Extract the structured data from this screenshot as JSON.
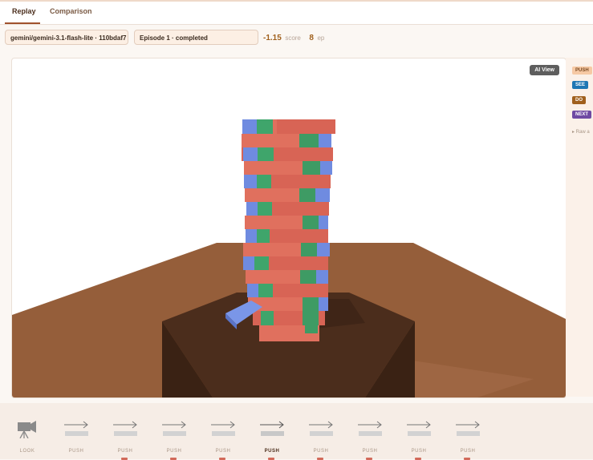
{
  "tabs": [
    {
      "label": "Replay",
      "active": true
    },
    {
      "label": "Comparison",
      "active": false
    }
  ],
  "toolbar": {
    "model": "gemini/gemini-3.1-flash-lite · 110bdaf7",
    "episode": "Episode 1 · completed",
    "score_value": "-1.15",
    "score_unit": "score",
    "ep_value": "8",
    "ep_unit": "ep"
  },
  "viewer": {
    "ai_view_label": "AI View"
  },
  "sidebar": {
    "tags": [
      {
        "label": "PUSH",
        "color": "#f6c9a4"
      },
      {
        "label": "SEE",
        "color": "#1f77b4"
      },
      {
        "label": "DO",
        "color": "#a0601d"
      },
      {
        "label": "NEXT",
        "color": "#6f4aa3"
      }
    ],
    "raw_label": "▸ Raw a"
  },
  "timeline": {
    "steps": [
      {
        "label": "LOOK",
        "icon": "camera-icon"
      },
      {
        "label": "PUSH",
        "icon": "arrow-right-icon"
      },
      {
        "label": "PUSH",
        "icon": "arrow-right-icon"
      },
      {
        "label": "PUSH",
        "icon": "arrow-right-icon"
      },
      {
        "label": "PUSH",
        "icon": "arrow-right-icon"
      },
      {
        "label": "PUSH",
        "icon": "arrow-right-icon",
        "active": true
      },
      {
        "label": "PUSH",
        "icon": "arrow-right-icon"
      },
      {
        "label": "PUSH",
        "icon": "arrow-right-icon"
      },
      {
        "label": "PUSH",
        "icon": "arrow-right-icon"
      },
      {
        "label": "PUSH",
        "icon": "arrow-right-icon"
      }
    ]
  }
}
